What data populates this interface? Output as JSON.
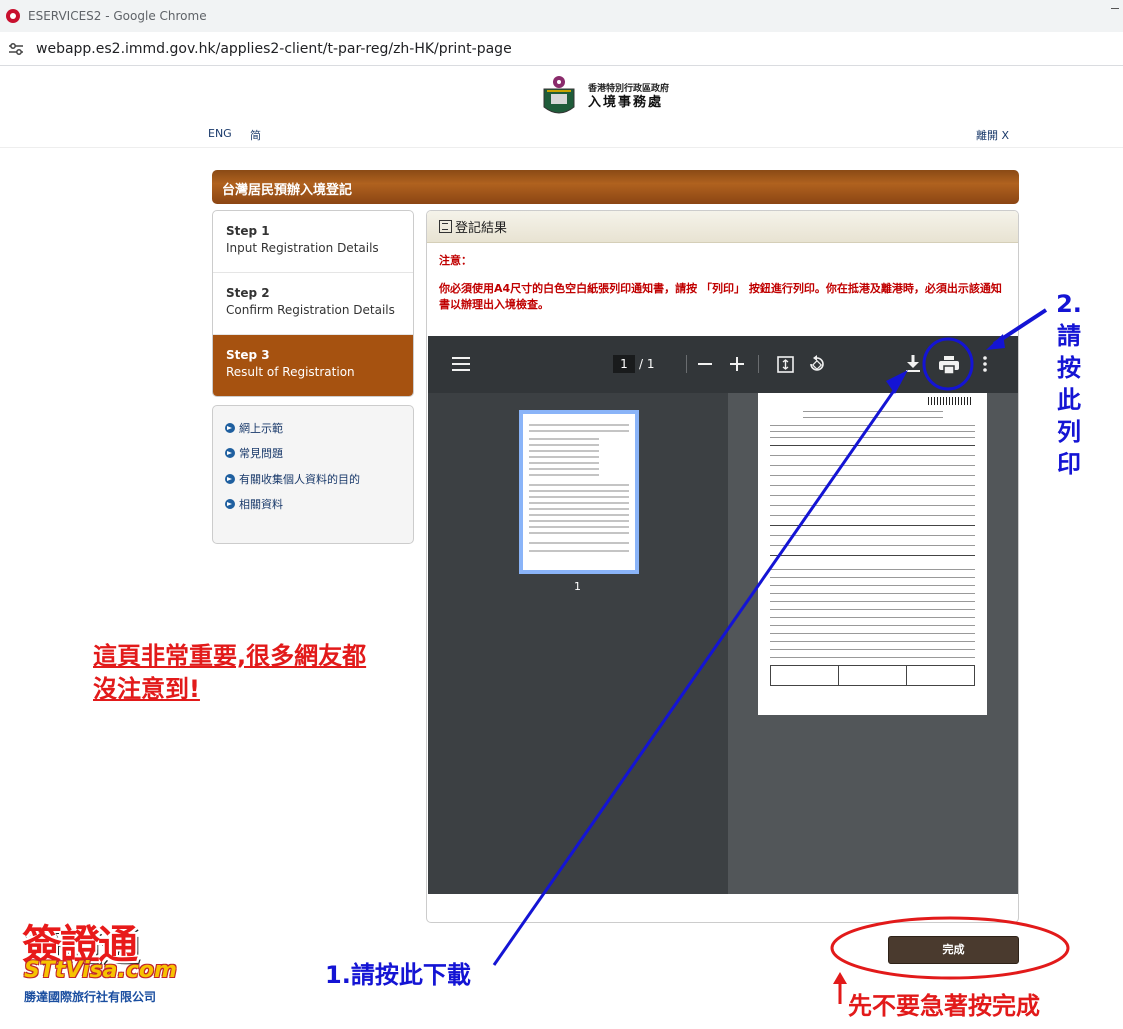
{
  "browser": {
    "tab_title": "ESERVICES2 - Google Chrome",
    "url": "webapp.es2.immd.gov.hk/applies2-client/t-par-reg/zh-HK/print-page"
  },
  "header": {
    "org_line1": "香港特別行政區政府",
    "org_line2": "入境事務處",
    "lang_eng": "ENG",
    "lang_simplified": "简",
    "logout": "離開 X"
  },
  "page_title": "台灣居民預辦入境登記",
  "steps": [
    {
      "num": "Step 1",
      "label": "Input Registration Details"
    },
    {
      "num": "Step 2",
      "label": "Confirm Registration Details"
    },
    {
      "num": "Step 3",
      "label": "Result of Registration"
    }
  ],
  "links": [
    "網上示範",
    "常見問題",
    "有關收集個人資料的目的",
    "相關資料"
  ],
  "panel": {
    "title": "登記結果",
    "notice_title": "注意：",
    "notice_body": "你必須使用A4尺寸的白色空白紙張列印通知書，請按 「列印」 按鈕進行列印。你在抵港及離港時，必須出示該通知書以辦理出入境檢查。"
  },
  "pdf_viewer": {
    "page_current": "1",
    "page_total": "/ 1",
    "thumbnail_label": "1",
    "menu_icon": "menu-icon",
    "zoom_out_icon": "minus-icon",
    "zoom_in_icon": "plus-icon",
    "download_icon": "download-icon",
    "print_icon": "print-icon",
    "more_icon": "more-vert-icon"
  },
  "done_button": "完成",
  "annotations": {
    "important_note_l1": "這頁非常重要,很多網友都",
    "important_note_l2": "沒注意到!",
    "step2_num": "2.",
    "step2_chars": [
      "請",
      "按",
      "此",
      "列",
      "印"
    ],
    "step1_text": "1.請按此下載",
    "hold_text": "先不要急著按完成"
  },
  "watermark": {
    "cjk": "簽證通",
    "en": "STtVisa.com",
    "company": "勝達國際旅行社有限公司"
  },
  "colors": {
    "banner": "#a65210",
    "notice_red": "#c00000",
    "annotation_red": "#e21a1a",
    "annotation_blue": "#1414d4",
    "viewer_toolbar": "#323639"
  }
}
